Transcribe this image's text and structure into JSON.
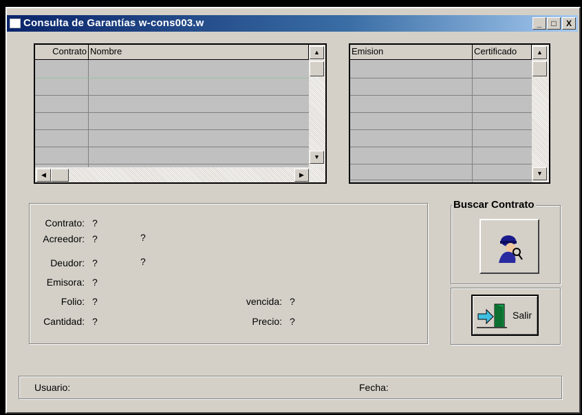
{
  "window": {
    "title": "Consulta  de Garantías w-cons003.w",
    "minimize_glyph": "_",
    "maximize_glyph": "□",
    "close_glyph": "X"
  },
  "contracts_grid": {
    "columns": [
      "Contrato",
      "Nombre"
    ],
    "rows": [
      "",
      "",
      "",
      "",
      "",
      ""
    ],
    "scroll_up_glyph": "▲",
    "scroll_down_glyph": "▼",
    "scroll_left_glyph": "◀",
    "scroll_right_glyph": "▶"
  },
  "certificates_grid": {
    "columns": [
      "Emision",
      "Certificado"
    ],
    "rows": [
      "",
      "",
      "",
      "",
      "",
      "",
      ""
    ],
    "scroll_up_glyph": "▲",
    "scroll_down_glyph": "▼"
  },
  "info": {
    "contrato_label": "Contrato:",
    "contrato_value": "?",
    "acreedor_label": "Acreedor:",
    "acreedor_value": "?",
    "acreedor_name": "?",
    "deudor_label": "Deudor:",
    "deudor_value": "?",
    "deudor_name": "?",
    "emisora_label": "Emisora:",
    "emisora_value": "?",
    "folio_label": "Folio:",
    "folio_value": "?",
    "vencida_label": "vencida:",
    "vencida_value": "?",
    "cantidad_label": "Cantidad:",
    "cantidad_value": "?",
    "precio_label": "Precio:",
    "precio_value": "?"
  },
  "buscar": {
    "group_title": "Buscar Contrato",
    "icon": "detective-search-icon"
  },
  "salir": {
    "label": "Salir",
    "icon": "exit-door-icon"
  },
  "status": {
    "usuario_label": "Usuario:",
    "fecha_label": "Fecha:"
  },
  "colors": {
    "title_active": "#0a246a",
    "face": "#d4d0c8",
    "grid_bg": "#c0c0c0"
  }
}
